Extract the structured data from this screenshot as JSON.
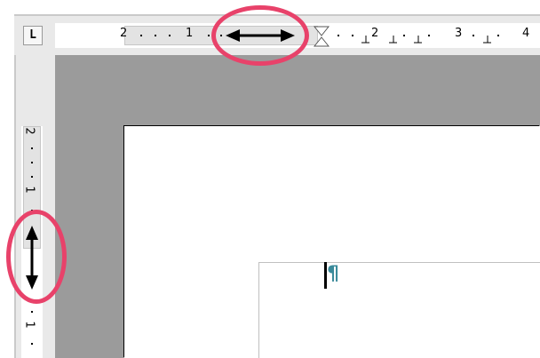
{
  "tab_selector": {
    "glyph": "L"
  },
  "horizontal_ruler": {
    "labels": [
      "2",
      "1",
      "2",
      "3",
      "4"
    ]
  },
  "vertical_ruler": {
    "labels": [
      "2",
      "1",
      "1"
    ]
  },
  "document": {
    "formatting_mark": "¶"
  },
  "annotations": {
    "ring_color": "#e8426a",
    "arrow_color": "#000000",
    "horizontal_ring_icon": "double-arrow-horizontal-icon",
    "vertical_ring_icon": "double-arrow-vertical-icon"
  }
}
